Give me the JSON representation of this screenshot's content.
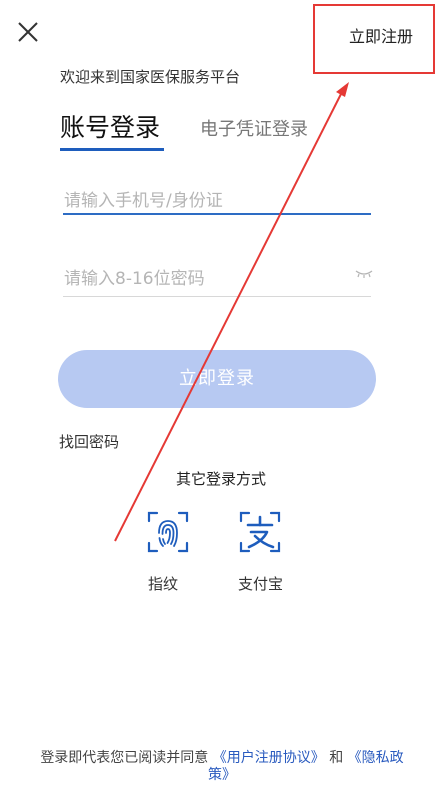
{
  "header": {
    "close_icon": "close-icon",
    "register_label": "立即注册"
  },
  "welcome_text": "欢迎来到国家医保服务平台",
  "tabs": [
    {
      "label": "账号登录",
      "active": true
    },
    {
      "label": "电子凭证登录",
      "active": false
    }
  ],
  "form": {
    "phone_placeholder": "请输入手机号/身份证",
    "password_placeholder": "请输入8-16位密码",
    "password_toggle_icon": "eye-closed-icon",
    "login_button_label": "立即登录",
    "find_password_label": "找回密码"
  },
  "other_login": {
    "title": "其它登录方式",
    "methods": [
      {
        "label": "指纹",
        "icon": "fingerprint-icon"
      },
      {
        "label": "支付宝",
        "icon": "alipay-icon"
      }
    ]
  },
  "agreement": {
    "prefix": "登录即代表您已阅读并同意",
    "user_agreement": "《用户注册协议》",
    "and": "和",
    "privacy_policy": "《隐私政策》"
  },
  "colors": {
    "accent": "#1e5dbd",
    "login_button": "#b7c9f2",
    "annotation_red": "#e53935"
  }
}
